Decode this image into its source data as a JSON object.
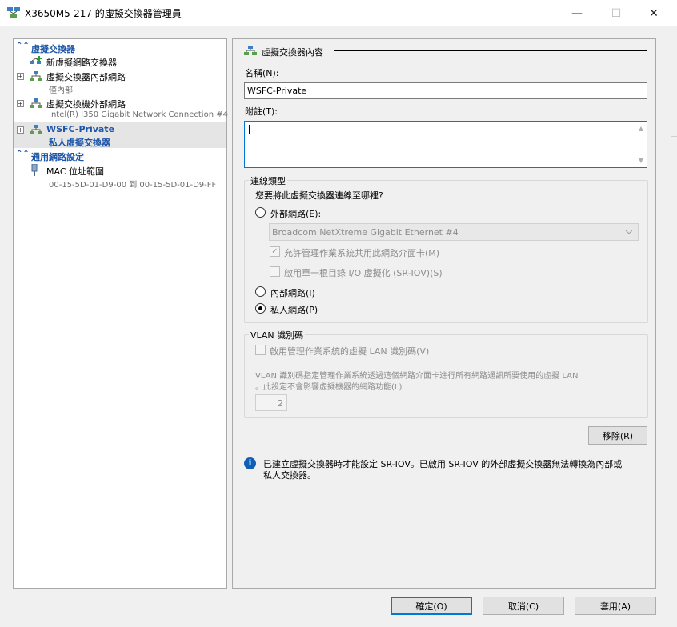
{
  "window": {
    "title": "X3650M5-217 的虛擬交換器管理員",
    "minimize_glyph": "—",
    "maximize_glyph": "☐",
    "close_glyph": "✕"
  },
  "tree": {
    "sections": [
      {
        "label": "虛擬交換器",
        "chevron": "⌃⌃"
      },
      {
        "label": "通用網路設定",
        "chevron": "⌃⌃"
      }
    ],
    "new_switch_label": "新虛擬網路交換器",
    "items": [
      {
        "expander": "+",
        "title": "虛擬交換器內部網路",
        "sub": "僅內部"
      },
      {
        "expander": "+",
        "title": "虛擬交換機外部網路",
        "sub": "Intel(R) I350 Gigabit Network Connection #4"
      },
      {
        "expander": "+",
        "title": "WSFC-Private",
        "sub": "私人虛擬交換器"
      }
    ],
    "mac_title": "MAC 位址範圍",
    "mac_range": "00-15-5D-01-D9-00 到 00-15-5D-01-D9-FF"
  },
  "props": {
    "header": "虛擬交換器內容",
    "name_label": "名稱(N):",
    "name_value": "WSFC-Private",
    "notes_label": "附註(T):",
    "notes_value": "",
    "conn_group": "連線類型",
    "conn_question": "您要將此虛擬交換器連線至哪裡?",
    "external_label": "外部網路(E):",
    "adapter_value": "Broadcom NetXtreme Gigabit Ethernet #4",
    "allow_mgmt_label": "允許管理作業系統共用此網路介面卡(M)",
    "sriov_label": "啟用單一根目錄 I/O 虛擬化 (SR-IOV)(S)",
    "internal_label": "內部網路(I)",
    "private_label": "私人網路(P)",
    "selected_type": "private",
    "vlan_group": "VLAN 識別碼",
    "vlan_enable_label": "啟用管理作業系統的虛擬 LAN 識別碼(V)",
    "vlan_desc_1": "VLAN 識別碼指定管理作業系統透過這個網路介面卡進行所有網路通訊所要使用的虛擬 LAN",
    "vlan_desc_2": "。此設定不會影響虛擬機器的網路功能(L)",
    "vlan_value": "2",
    "remove_label": "移除(R)",
    "info_icon_glyph": "i",
    "info_line_1": "已建立虛擬交換器時才能設定 SR-IOV。已啟用 SR-IOV 的外部虛擬交換器無法轉換為內部或",
    "info_line_2": "私人交換器。"
  },
  "buttons": {
    "ok": "確定(O)",
    "cancel": "取消(C)",
    "apply": "套用(A)"
  },
  "colors": {
    "accent": "#1d55a8",
    "focus": "#0078d7",
    "selection": "#e5e5e5"
  }
}
